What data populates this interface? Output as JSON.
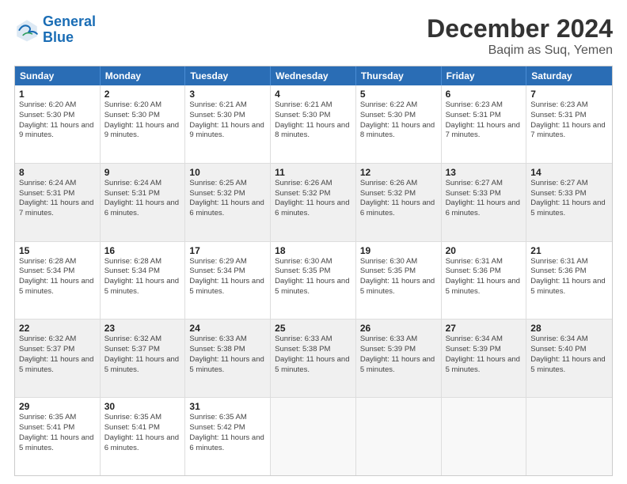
{
  "logo": {
    "line1": "General",
    "line2": "Blue"
  },
  "title": "December 2024",
  "subtitle": "Baqim as Suq, Yemen",
  "days": [
    "Sunday",
    "Monday",
    "Tuesday",
    "Wednesday",
    "Thursday",
    "Friday",
    "Saturday"
  ],
  "weeks": [
    [
      {
        "num": "1",
        "sunrise": "6:20 AM",
        "sunset": "5:30 PM",
        "daylight": "11 hours and 9 minutes."
      },
      {
        "num": "2",
        "sunrise": "6:20 AM",
        "sunset": "5:30 PM",
        "daylight": "11 hours and 9 minutes."
      },
      {
        "num": "3",
        "sunrise": "6:21 AM",
        "sunset": "5:30 PM",
        "daylight": "11 hours and 9 minutes."
      },
      {
        "num": "4",
        "sunrise": "6:21 AM",
        "sunset": "5:30 PM",
        "daylight": "11 hours and 8 minutes."
      },
      {
        "num": "5",
        "sunrise": "6:22 AM",
        "sunset": "5:30 PM",
        "daylight": "11 hours and 8 minutes."
      },
      {
        "num": "6",
        "sunrise": "6:23 AM",
        "sunset": "5:31 PM",
        "daylight": "11 hours and 7 minutes."
      },
      {
        "num": "7",
        "sunrise": "6:23 AM",
        "sunset": "5:31 PM",
        "daylight": "11 hours and 7 minutes."
      }
    ],
    [
      {
        "num": "8",
        "sunrise": "6:24 AM",
        "sunset": "5:31 PM",
        "daylight": "11 hours and 7 minutes."
      },
      {
        "num": "9",
        "sunrise": "6:24 AM",
        "sunset": "5:31 PM",
        "daylight": "11 hours and 6 minutes."
      },
      {
        "num": "10",
        "sunrise": "6:25 AM",
        "sunset": "5:32 PM",
        "daylight": "11 hours and 6 minutes."
      },
      {
        "num": "11",
        "sunrise": "6:26 AM",
        "sunset": "5:32 PM",
        "daylight": "11 hours and 6 minutes."
      },
      {
        "num": "12",
        "sunrise": "6:26 AM",
        "sunset": "5:32 PM",
        "daylight": "11 hours and 6 minutes."
      },
      {
        "num": "13",
        "sunrise": "6:27 AM",
        "sunset": "5:33 PM",
        "daylight": "11 hours and 6 minutes."
      },
      {
        "num": "14",
        "sunrise": "6:27 AM",
        "sunset": "5:33 PM",
        "daylight": "11 hours and 5 minutes."
      }
    ],
    [
      {
        "num": "15",
        "sunrise": "6:28 AM",
        "sunset": "5:34 PM",
        "daylight": "11 hours and 5 minutes."
      },
      {
        "num": "16",
        "sunrise": "6:28 AM",
        "sunset": "5:34 PM",
        "daylight": "11 hours and 5 minutes."
      },
      {
        "num": "17",
        "sunrise": "6:29 AM",
        "sunset": "5:34 PM",
        "daylight": "11 hours and 5 minutes."
      },
      {
        "num": "18",
        "sunrise": "6:30 AM",
        "sunset": "5:35 PM",
        "daylight": "11 hours and 5 minutes."
      },
      {
        "num": "19",
        "sunrise": "6:30 AM",
        "sunset": "5:35 PM",
        "daylight": "11 hours and 5 minutes."
      },
      {
        "num": "20",
        "sunrise": "6:31 AM",
        "sunset": "5:36 PM",
        "daylight": "11 hours and 5 minutes."
      },
      {
        "num": "21",
        "sunrise": "6:31 AM",
        "sunset": "5:36 PM",
        "daylight": "11 hours and 5 minutes."
      }
    ],
    [
      {
        "num": "22",
        "sunrise": "6:32 AM",
        "sunset": "5:37 PM",
        "daylight": "11 hours and 5 minutes."
      },
      {
        "num": "23",
        "sunrise": "6:32 AM",
        "sunset": "5:37 PM",
        "daylight": "11 hours and 5 minutes."
      },
      {
        "num": "24",
        "sunrise": "6:33 AM",
        "sunset": "5:38 PM",
        "daylight": "11 hours and 5 minutes."
      },
      {
        "num": "25",
        "sunrise": "6:33 AM",
        "sunset": "5:38 PM",
        "daylight": "11 hours and 5 minutes."
      },
      {
        "num": "26",
        "sunrise": "6:33 AM",
        "sunset": "5:39 PM",
        "daylight": "11 hours and 5 minutes."
      },
      {
        "num": "27",
        "sunrise": "6:34 AM",
        "sunset": "5:39 PM",
        "daylight": "11 hours and 5 minutes."
      },
      {
        "num": "28",
        "sunrise": "6:34 AM",
        "sunset": "5:40 PM",
        "daylight": "11 hours and 5 minutes."
      }
    ],
    [
      {
        "num": "29",
        "sunrise": "6:35 AM",
        "sunset": "5:41 PM",
        "daylight": "11 hours and 5 minutes."
      },
      {
        "num": "30",
        "sunrise": "6:35 AM",
        "sunset": "5:41 PM",
        "daylight": "11 hours and 6 minutes."
      },
      {
        "num": "31",
        "sunrise": "6:35 AM",
        "sunset": "5:42 PM",
        "daylight": "11 hours and 6 minutes."
      },
      null,
      null,
      null,
      null
    ]
  ]
}
